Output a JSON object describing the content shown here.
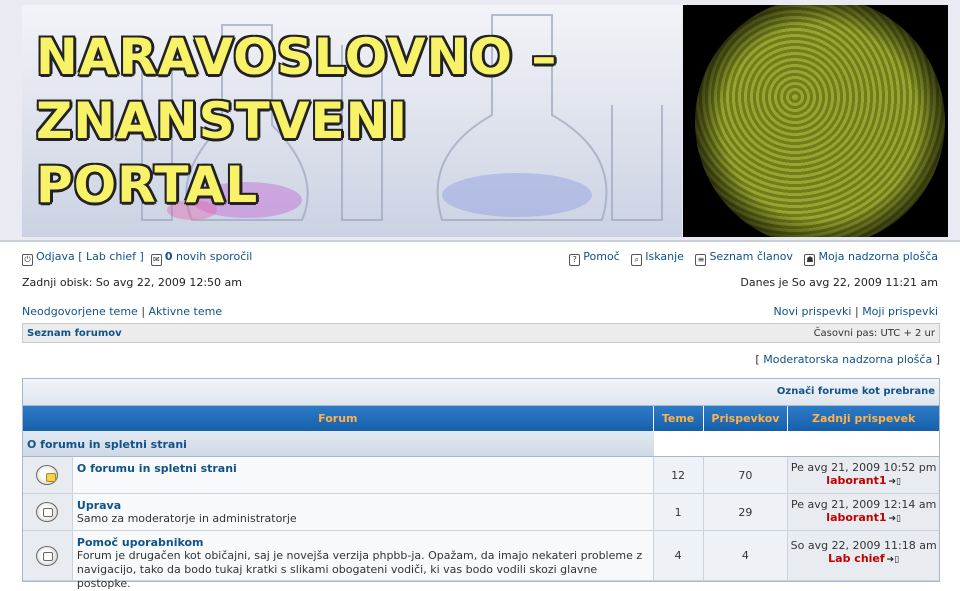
{
  "banner": {
    "title_lines": [
      "NARAVOSLOVNO –",
      "ZNANSTVENI",
      "PORTAL"
    ]
  },
  "topnav": {
    "logout": "Odjava",
    "user": "[ Lab chief ]",
    "new_count": "0",
    "new_messages": "novih sporočil",
    "help": "Pomoč",
    "search": "Iskanje",
    "members": "Seznam članov",
    "ucp": "Moja nadzorna plošča"
  },
  "info": {
    "last_visit": "Zadnji obisk: So avg 22, 2009 12:50 am",
    "today": "Danes je So avg 22, 2009 11:21 am"
  },
  "quicklinks": {
    "unanswered": "Neodgovorjene teme",
    "active": "Aktivne teme",
    "new_posts": "Novi prispevki",
    "my_posts": "Moji prispevki"
  },
  "breadcrumb": {
    "index": "Seznam forumov",
    "timezone": "Časovni pas: UTC + 2 ur"
  },
  "mod_panel": {
    "label": "Moderatorska nadzorna plošča"
  },
  "table": {
    "mark_read": "Označi forume kot prebrane",
    "headers": {
      "forum": "Forum",
      "topics": "Teme",
      "posts": "Prispevkov",
      "last_post": "Zadnji prispevek"
    },
    "category": "O forumu in spletni strani",
    "forums": [
      {
        "name": "O forumu in spletni strani",
        "desc": "",
        "topics": "12",
        "posts": "70",
        "last_date": "Pe avg 21, 2009 10:52 pm",
        "last_user": "laborant1"
      },
      {
        "name": "Uprava",
        "desc": "Samo za moderatorje in administratorje",
        "topics": "1",
        "posts": "29",
        "last_date": "Pe avg 21, 2009 12:14 am",
        "last_user": "laborant1"
      },
      {
        "name": "Pomoč uporabnikom",
        "desc": "Forum je drugačen kot običajni, saj je novejša verzija phpbb-ja. Opažam, da imajo nekateri probleme z navigacijo, tako da bodo tukaj kratki s slikami obogateni vodiči, ki vas bodo vodili skozi glavne postopke.",
        "topics": "4",
        "posts": "4",
        "last_date": "So avg 22, 2009 11:18 am",
        "last_user": "Lab chief"
      }
    ]
  }
}
